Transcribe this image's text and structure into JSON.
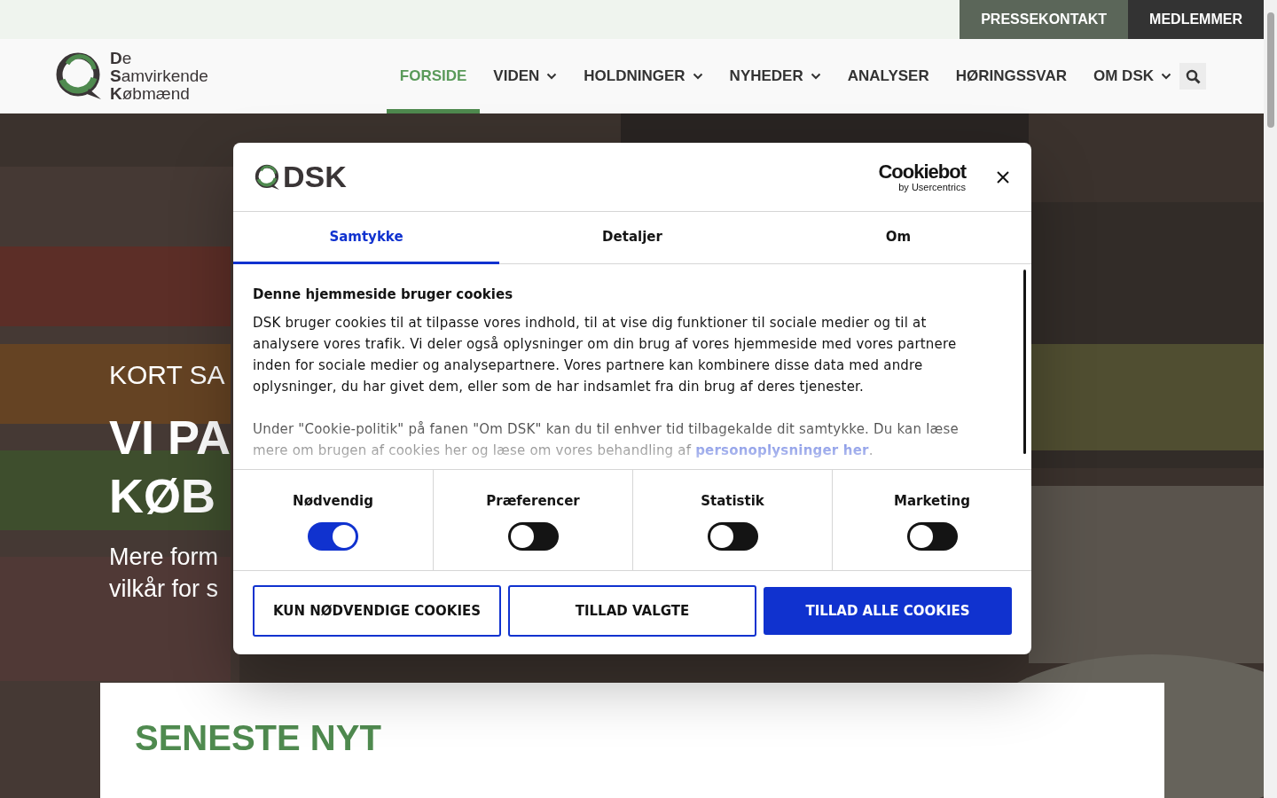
{
  "top_bar": {
    "buttons": [
      {
        "label": "PRESSEKONTAKT",
        "kind": "secondary"
      },
      {
        "label": "MEDLEMMER",
        "kind": "primary"
      }
    ]
  },
  "header": {
    "logo_lines": [
      "**D**e",
      "**S**amvirkende",
      "**K**øbmænd"
    ],
    "nav": [
      {
        "label": "FORSIDE",
        "selected": true,
        "has_dropdown": false
      },
      {
        "label": "VIDEN",
        "selected": false,
        "has_dropdown": true
      },
      {
        "label": "HOLDNINGER",
        "selected": false,
        "has_dropdown": true
      },
      {
        "label": "NYHEDER",
        "selected": false,
        "has_dropdown": true
      },
      {
        "label": "ANALYSER",
        "selected": false,
        "has_dropdown": false
      },
      {
        "label": "HØRINGSSVAR",
        "selected": false,
        "has_dropdown": false
      },
      {
        "label": "OM DSK",
        "selected": false,
        "has_dropdown": true
      }
    ]
  },
  "hero": {
    "kicker": "KORT SA",
    "headline_lines": [
      "VI PA",
      "KØB"
    ],
    "subtitle_lines": [
      "Mere form",
      "vilkår for s"
    ]
  },
  "news_card": {
    "title": "SENESTE NYT"
  },
  "cookie_dialog": {
    "brand": "DSK",
    "provider": "Cookiebot",
    "provider_sub": "by Usercentrics",
    "tabs": [
      {
        "label": "Samtykke",
        "selected": true
      },
      {
        "label": "Detaljer",
        "selected": false
      },
      {
        "label": "Om",
        "selected": false
      }
    ],
    "heading": "Denne hjemmeside bruger cookies",
    "paragraph_1": "DSK bruger cookies til at tilpasse vores indhold, til at vise dig funktioner til sociale medier og til at analysere vores trafik. Vi deler også oplysninger om din brug af vores hjemmeside med vores partnere inden for sociale medier og analysepartnere. Vores partnere kan kombinere disse data med andre oplysninger, du har givet dem, eller som de har indsamlet fra din brug af deres tjenester.",
    "paragraph_2": {
      "text": "Under \"Cookie-politik\" på fanen \"Om DSK\" kan du til enhver tid tilbagekalde dit samtykke. Du kan læse mere om brugen af cookies her og læse om vores behandling af ",
      "link": "personoplysninger her",
      "after": "."
    },
    "categories": [
      {
        "label": "Nødvendig",
        "on": true
      },
      {
        "label": "Præferencer",
        "on": false
      },
      {
        "label": "Statistik",
        "on": false
      },
      {
        "label": "Marketing",
        "on": false
      }
    ],
    "buttons": [
      {
        "label": "KUN NØDVENDIGE COOKIES",
        "kind": "outline"
      },
      {
        "label": "TILLAD VALGTE",
        "kind": "outline"
      },
      {
        "label": "TILLAD ALLE COOKIES",
        "kind": "filled"
      }
    ]
  }
}
